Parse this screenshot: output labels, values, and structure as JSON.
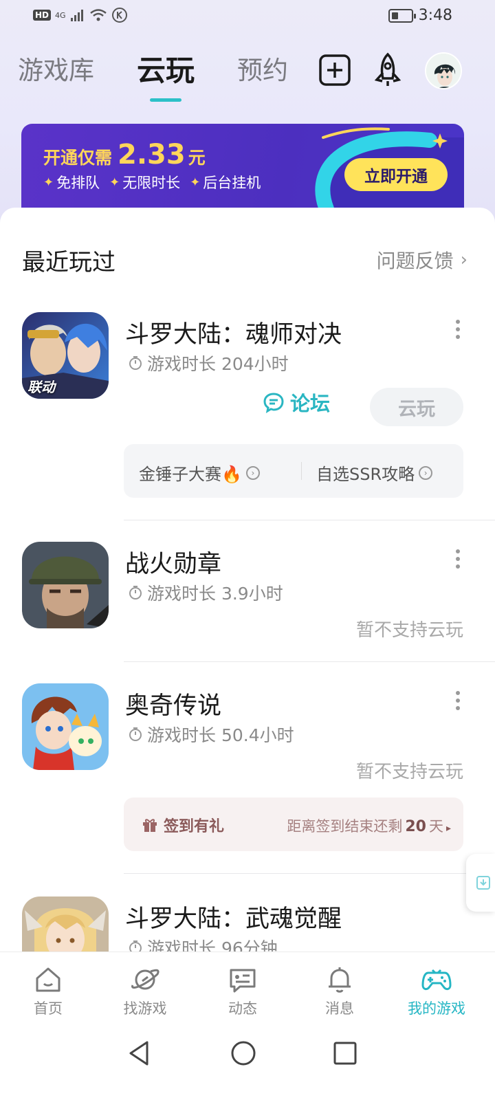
{
  "status_bar": {
    "network_badge": "HD",
    "signal_label": "4G",
    "time": "3:48",
    "battery_level": 0.3
  },
  "header": {
    "tabs": [
      {
        "label": "游戏库",
        "active": false
      },
      {
        "label": "云玩",
        "active": true
      },
      {
        "label": "预约",
        "active": false
      }
    ],
    "icons": [
      "add-icon",
      "rocket-icon"
    ]
  },
  "banner": {
    "title_prefix": "开通仅需",
    "price": "2.33",
    "price_unit": "元",
    "features": [
      "免排队",
      "无限时长",
      "后台挂机"
    ],
    "cta": "立即开通"
  },
  "recent": {
    "title": "最近玩过",
    "feedback": "问题反馈"
  },
  "games": [
    {
      "name": "斗罗大陆：魂师对决",
      "playtime": "游戏时长 204小时",
      "icon_label": "联动",
      "forum_label": "论坛",
      "cloud_label": "云玩",
      "tags": [
        "金锤子大赛🔥",
        "自选SSR攻略"
      ]
    },
    {
      "name": "战火勋章",
      "playtime": "游戏时长 3.9小时",
      "unsupported": "暂不支持云玩"
    },
    {
      "name": "奥奇传说",
      "playtime": "游戏时长 50.4小时",
      "unsupported": "暂不支持云玩",
      "checkin": {
        "label": "签到有礼",
        "remaining_prefix": "距离签到结束还剩",
        "remaining_days": "20",
        "remaining_suffix": "天"
      }
    },
    {
      "name": "斗罗大陆：武魂觉醒",
      "playtime": "游戏时长 96分钟"
    }
  ],
  "bottom_nav": [
    {
      "label": "首页",
      "icon": "home-icon",
      "active": false
    },
    {
      "label": "找游戏",
      "icon": "planet-icon",
      "active": false
    },
    {
      "label": "动态",
      "icon": "chat-card-icon",
      "active": false
    },
    {
      "label": "消息",
      "icon": "bell-icon",
      "active": false
    },
    {
      "label": "我的游戏",
      "icon": "gamepad-icon",
      "active": true
    }
  ],
  "colors": {
    "accent": "#25b6c4",
    "banner_bg": "#4c2fbf",
    "banner_gold": "#ffd65a"
  }
}
